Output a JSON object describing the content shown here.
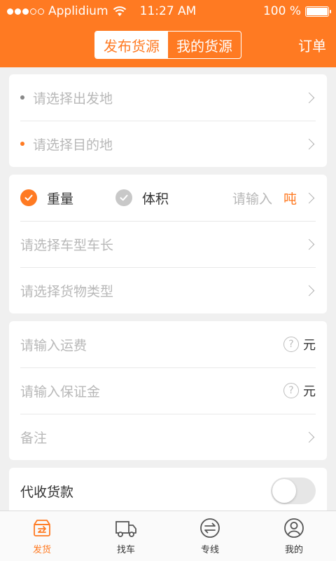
{
  "status": {
    "carrier": "Applidium",
    "time": "11:27 AM",
    "battery": "100 %"
  },
  "header": {
    "tabs": [
      {
        "label": "发布货源",
        "active": true
      },
      {
        "label": "我的货源",
        "active": false
      }
    ],
    "right_label": "订单"
  },
  "route": {
    "origin_placeholder": "请选择出发地",
    "destination_placeholder": "请选择目的地"
  },
  "cargo": {
    "weight_label": "重量",
    "volume_label": "体积",
    "amount_placeholder": "请输入",
    "amount_unit": "吨",
    "vehicle_placeholder": "请选择车型车长",
    "goods_type_placeholder": "请选择货物类型"
  },
  "fees": {
    "freight_placeholder": "请输入运费",
    "freight_unit": "元",
    "deposit_placeholder": "请输入保证金",
    "deposit_unit": "元",
    "remark_placeholder": "备注"
  },
  "collection": {
    "label": "代收货款",
    "enabled": false
  },
  "tabbar": {
    "items": [
      {
        "label": "发货",
        "icon": "ship-box-icon",
        "active": true
      },
      {
        "label": "找车",
        "icon": "truck-icon",
        "active": false
      },
      {
        "label": "专线",
        "icon": "exchange-arrows-icon",
        "active": false
      },
      {
        "label": "我的",
        "icon": "user-icon",
        "active": false
      }
    ]
  },
  "colors": {
    "accent": "#ff7a22",
    "background": "#f0f0f0",
    "placeholder": "#b8b8b8"
  }
}
